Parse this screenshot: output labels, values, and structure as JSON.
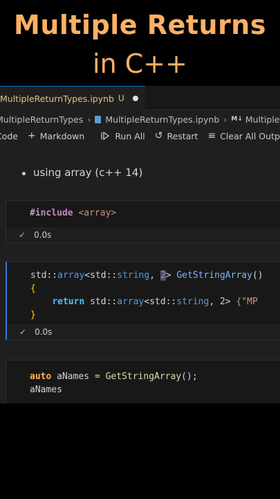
{
  "title": {
    "line1": "Multiple Returns",
    "line2": "in C++"
  },
  "tab": {
    "name": "MultipleReturnTypes.ipynb",
    "status": "U"
  },
  "breadcrumb": {
    "folder": "MultipleReturnTypes",
    "file": "MultipleReturnTypes.ipynb",
    "section_icon": "M↓",
    "section": "Multiple Ret"
  },
  "toolbar": {
    "code": "Code",
    "markdown": "Markdown",
    "run_all": "Run All",
    "restart": "Restart",
    "clear_all": "Clear All Outp"
  },
  "markdown_cell": {
    "text": "using array (c++ 14)"
  },
  "cell1": {
    "hash": "#",
    "include": "include",
    "header": "<array>",
    "time": "0.0s"
  },
  "cell2": {
    "l1_std": "std::",
    "l1_array": "array",
    "l1_lt": "<",
    "l1_std2": "std::",
    "l1_string": "string",
    "l1_comma": ", ",
    "l1_sel": "2",
    "l1_gt": ">",
    "l1_fn": " GetStringArray",
    "l1_paren": "()",
    "l2": "{",
    "l3_ret": "return",
    "l3_std": " std::",
    "l3_array": "array",
    "l3_lt": "<",
    "l3_std2": "std::",
    "l3_string": "string",
    "l3_rest": ", 2> ",
    "l3_brace": "{",
    "l3_str": "\"MP",
    "l4": "}",
    "time": "0.0s"
  },
  "cell3": {
    "l1_auto": "auto",
    "l1_var": " aNames ",
    "l1_eq": "= ",
    "l1_fn": "GetStringArray",
    "l1_end": "();",
    "l2": "aNames"
  },
  "colors": {
    "title": "#ffb066",
    "editor_bg": "#1f1f1f",
    "accent_blue": "#2d7fd2",
    "check_green": "#89d185"
  }
}
